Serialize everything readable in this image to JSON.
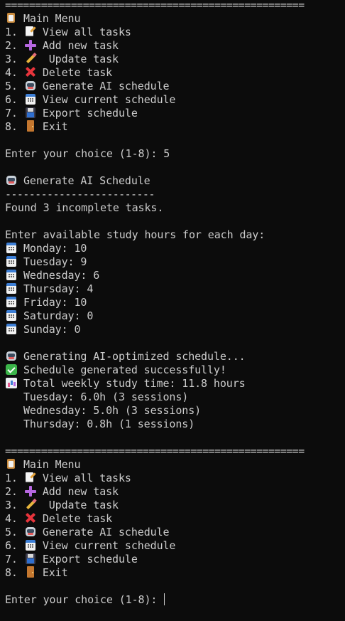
{
  "separator": "==================================================",
  "sub_separator": "-------------------------",
  "menu_top": {
    "title": "Main Menu",
    "items": [
      {
        "num": "1.",
        "label": "View all tasks"
      },
      {
        "num": "2.",
        "label": "Add new task"
      },
      {
        "num": "3.",
        "label": " Update task"
      },
      {
        "num": "4.",
        "label": "Delete task"
      },
      {
        "num": "5.",
        "label": "Generate AI schedule"
      },
      {
        "num": "6.",
        "label": "View current schedule"
      },
      {
        "num": "7.",
        "label": "Export schedule"
      },
      {
        "num": "8.",
        "label": "Exit"
      }
    ]
  },
  "prompt_first": {
    "text": "Enter your choice (1-8): ",
    "value": "5"
  },
  "section": {
    "title": "Generate AI Schedule",
    "found": "Found 3 incomplete tasks.",
    "hours_prompt": "Enter available study hours for each day:",
    "days": [
      {
        "label": "Monday: ",
        "value": "10"
      },
      {
        "label": "Tuesday: ",
        "value": "9"
      },
      {
        "label": "Wednesday: ",
        "value": "6"
      },
      {
        "label": "Thursday: ",
        "value": "4"
      },
      {
        "label": "Friday: ",
        "value": "10"
      },
      {
        "label": "Saturday: ",
        "value": "0"
      },
      {
        "label": "Sunday: ",
        "value": "0"
      }
    ],
    "generating": "Generating AI-optimized schedule...",
    "success": "Schedule generated successfully!",
    "total": "Total weekly study time: 11.8 hours",
    "breakdown": [
      "Tuesday: 6.0h (3 sessions)",
      "Wednesday: 5.0h (3 sessions)",
      "Thursday: 0.8h (1 sessions)"
    ]
  },
  "menu_bottom": {
    "title": "Main Menu",
    "items": [
      {
        "num": "1.",
        "label": "View all tasks"
      },
      {
        "num": "2.",
        "label": "Add new task"
      },
      {
        "num": "3.",
        "label": " Update task"
      },
      {
        "num": "4.",
        "label": "Delete task"
      },
      {
        "num": "5.",
        "label": "Generate AI schedule"
      },
      {
        "num": "6.",
        "label": "View current schedule"
      },
      {
        "num": "7.",
        "label": "Export schedule"
      },
      {
        "num": "8.",
        "label": "Exit"
      }
    ]
  },
  "prompt_last": {
    "text": "Enter your choice (1-8): "
  },
  "icons": {
    "menu_title": "clipboard-icon",
    "items": [
      "memo-icon",
      "plus-icon",
      "pencil-icon",
      "cross-mark-icon",
      "robot-icon",
      "calendar-icon",
      "floppy-disk-icon",
      "door-icon"
    ],
    "day": "calendar-icon",
    "generating": "robot-icon",
    "success": "check-mark-icon",
    "total": "bar-chart-icon"
  },
  "colors": {
    "background": "#0c0c0c",
    "foreground": "#cccccc"
  }
}
